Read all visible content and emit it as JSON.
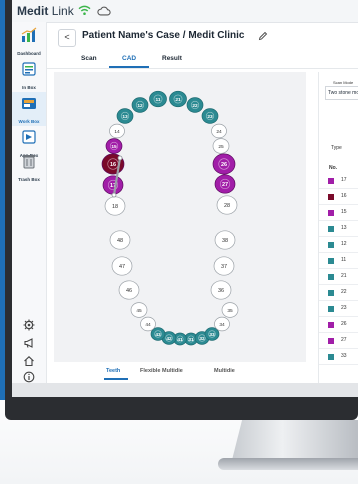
{
  "app": {
    "brand": "Medit",
    "product": "Link"
  },
  "sidebar": {
    "items": [
      {
        "label": "Dashboard"
      },
      {
        "label": "In Box"
      },
      {
        "label": "Work Box"
      },
      {
        "label": "App Box"
      },
      {
        "label": "Trash Box"
      }
    ]
  },
  "header": {
    "back_label": "<",
    "title": "Patient Name's Case / Medit Clinic"
  },
  "tabs": [
    {
      "label": "Scan"
    },
    {
      "label": "CAD"
    },
    {
      "label": "Result"
    }
  ],
  "bottom_tabs": [
    {
      "label": "Teeth"
    },
    {
      "label": "Flexible Multidie"
    },
    {
      "label": "Multidie"
    }
  ],
  "right_panel": {
    "scan_mode_label": "Scan Mode",
    "scan_mode_value": "Two stone models",
    "type_header": "Type",
    "no_header": "No.",
    "rows": [
      {
        "no": "17",
        "color": "#a11ea8"
      },
      {
        "no": "16",
        "color": "#7a0a2a"
      },
      {
        "no": "15",
        "color": "#a11ea8"
      },
      {
        "no": "13",
        "color": "#2b8a92"
      },
      {
        "no": "12",
        "color": "#2b8a92"
      },
      {
        "no": "11",
        "color": "#2b8a92"
      },
      {
        "no": "21",
        "color": "#2b8a92"
      },
      {
        "no": "22",
        "color": "#2b8a92"
      },
      {
        "no": "23",
        "color": "#2b8a92"
      },
      {
        "no": "26",
        "color": "#a11ea8"
      },
      {
        "no": "27",
        "color": "#a11ea8"
      },
      {
        "no": "33",
        "color": "#2b8a92"
      }
    ]
  },
  "teeth": [
    {
      "no": "11",
      "state": "teal"
    },
    {
      "no": "12",
      "state": "teal"
    },
    {
      "no": "13",
      "state": "teal"
    },
    {
      "no": "14",
      "state": "white"
    },
    {
      "no": "15",
      "state": "purple"
    },
    {
      "no": "16",
      "state": "maroon"
    },
    {
      "no": "17",
      "state": "purple"
    },
    {
      "no": "18",
      "state": "white"
    },
    {
      "no": "21",
      "state": "teal"
    },
    {
      "no": "22",
      "state": "teal"
    },
    {
      "no": "23",
      "state": "teal"
    },
    {
      "no": "24",
      "state": "white"
    },
    {
      "no": "25",
      "state": "white"
    },
    {
      "no": "26",
      "state": "purple"
    },
    {
      "no": "27",
      "state": "purple"
    },
    {
      "no": "28",
      "state": "white"
    },
    {
      "no": "31",
      "state": "teal"
    },
    {
      "no": "32",
      "state": "teal"
    },
    {
      "no": "33",
      "state": "teal"
    },
    {
      "no": "34",
      "state": "white"
    },
    {
      "no": "35",
      "state": "white"
    },
    {
      "no": "36",
      "state": "white"
    },
    {
      "no": "37",
      "state": "white"
    },
    {
      "no": "38",
      "state": "white"
    },
    {
      "no": "41",
      "state": "teal"
    },
    {
      "no": "42",
      "state": "teal"
    },
    {
      "no": "43",
      "state": "teal"
    },
    {
      "no": "44",
      "state": "white"
    },
    {
      "no": "45",
      "state": "white"
    },
    {
      "no": "46",
      "state": "white"
    },
    {
      "no": "47",
      "state": "white"
    },
    {
      "no": "48",
      "state": "white"
    }
  ],
  "colors": {
    "teal": "#2b8a92",
    "purple": "#a11ea8",
    "maroon": "#7a0a2a",
    "white": "#ffffff",
    "accent": "#1f6fb6"
  },
  "icons": {
    "wifi": "wifi-icon",
    "cloud": "cloud-icon",
    "edit": "pencil-icon",
    "settings": "gear-icon",
    "notice": "megaphone-icon",
    "home": "home-icon",
    "info": "info-icon"
  }
}
